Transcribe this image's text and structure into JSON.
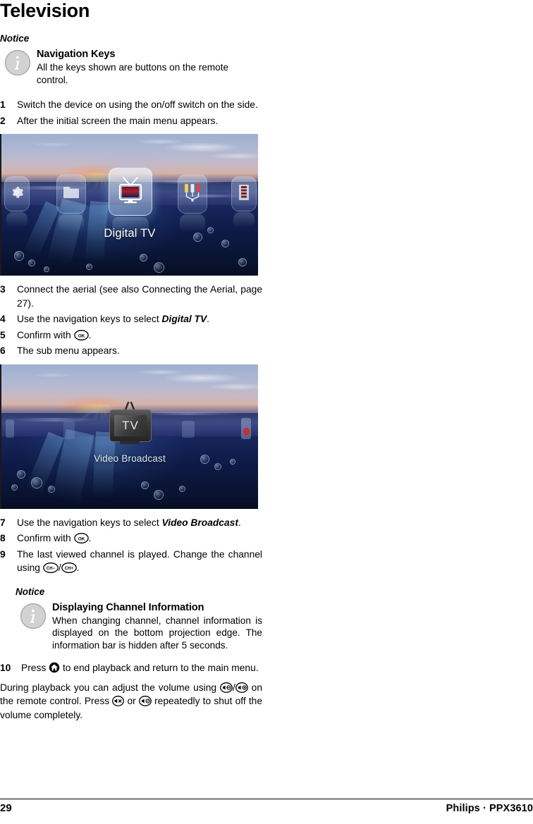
{
  "document": {
    "title": "Television"
  },
  "notice_top": {
    "label": "Notice",
    "icon": "info-icon",
    "title": "Navigation Keys",
    "text": "All the keys shown are buttons on the remote control."
  },
  "steps_first": [
    {
      "num": "1",
      "text_before": "Switch the device on using the on/off switch on the side.",
      "keys": []
    },
    {
      "num": "2",
      "text_before": "After the initial screen the main menu appears.",
      "keys": []
    }
  ],
  "screenshot_main_menu": {
    "name": "main-menu-screenshot",
    "label": "Digital TV",
    "tiles": [
      {
        "name": "settings-tile",
        "icon": "gear-icon"
      },
      {
        "name": "folder-tile",
        "icon": "folder-icon"
      },
      {
        "name": "digital-tv-tile",
        "icon": "tv-icon",
        "selected": true
      },
      {
        "name": "av-input-tile",
        "icon": "rca-connector-icon"
      },
      {
        "name": "video-tile",
        "icon": "film-strip-icon"
      }
    ]
  },
  "steps_second": [
    {
      "num": "3",
      "parts": [
        {
          "t": "text",
          "v": "Connect the aerial (see also Connecting the Aerial, page 27)."
        }
      ]
    },
    {
      "num": "4",
      "parts": [
        {
          "t": "text",
          "v": "Use the navigation keys to select "
        },
        {
          "t": "bolditalic",
          "v": "Digital TV"
        },
        {
          "t": "text",
          "v": "."
        }
      ]
    },
    {
      "num": "5",
      "parts": [
        {
          "t": "text",
          "v": "Confirm with "
        },
        {
          "t": "key",
          "v": "OK"
        },
        {
          "t": "text",
          "v": "."
        }
      ]
    },
    {
      "num": "6",
      "parts": [
        {
          "t": "text",
          "v": "The sub menu appears."
        }
      ]
    }
  ],
  "screenshot_sub_menu": {
    "name": "sub-menu-screenshot",
    "label": "Video Broadcast",
    "tv_screen_text": "TV"
  },
  "steps_third": [
    {
      "num": "7",
      "parts": [
        {
          "t": "text",
          "v": "Use the navigation keys to select "
        },
        {
          "t": "bolditalic",
          "v": "Video Broadcast"
        },
        {
          "t": "text",
          "v": "."
        }
      ]
    },
    {
      "num": "8",
      "parts": [
        {
          "t": "text",
          "v": "Confirm with "
        },
        {
          "t": "key",
          "v": "OK"
        },
        {
          "t": "text",
          "v": "."
        }
      ]
    },
    {
      "num": "9",
      "parts": [
        {
          "t": "text",
          "v": "The last viewed channel is played. Change the channel using "
        },
        {
          "t": "key",
          "v": "CH−"
        },
        {
          "t": "text",
          "v": "/"
        },
        {
          "t": "key",
          "v": "CH+"
        },
        {
          "t": "text",
          "v": "."
        }
      ]
    }
  ],
  "notice_bottom": {
    "label": "Notice",
    "icon": "info-icon",
    "title": "Displaying Channel Information",
    "text": "When changing channel, channel information is displayed on the bottom projection edge. The information bar is hidden after 5 seconds."
  },
  "step_ten": {
    "num": "10",
    "text_a": "Press ",
    "key": "home-icon",
    "text_b": " to end playback and return to the main menu."
  },
  "closing_paragraph": {
    "text_a": "During playback you can adjust the volume using ",
    "key_vol_down": "volume-down-icon",
    "sep": "/",
    "key_vol_up": "volume-up-icon",
    "text_b": " on the remote control. Press ",
    "key_mute": "mute-icon",
    "text_c": " or ",
    "key_vol_down2": "volume-down-icon",
    "text_d": " repeatedly to shut off the volume completely."
  },
  "footer": {
    "page_number": "29",
    "brand": "Philips · PPX3610"
  },
  "colors": {
    "text": "#000000",
    "notice_icon_fill": "#d0d0d0",
    "notice_icon_stroke": "#a8a8a8",
    "screenshot_dark_blue": "#0e1a45",
    "sunset_orange": "#ffce6e"
  }
}
